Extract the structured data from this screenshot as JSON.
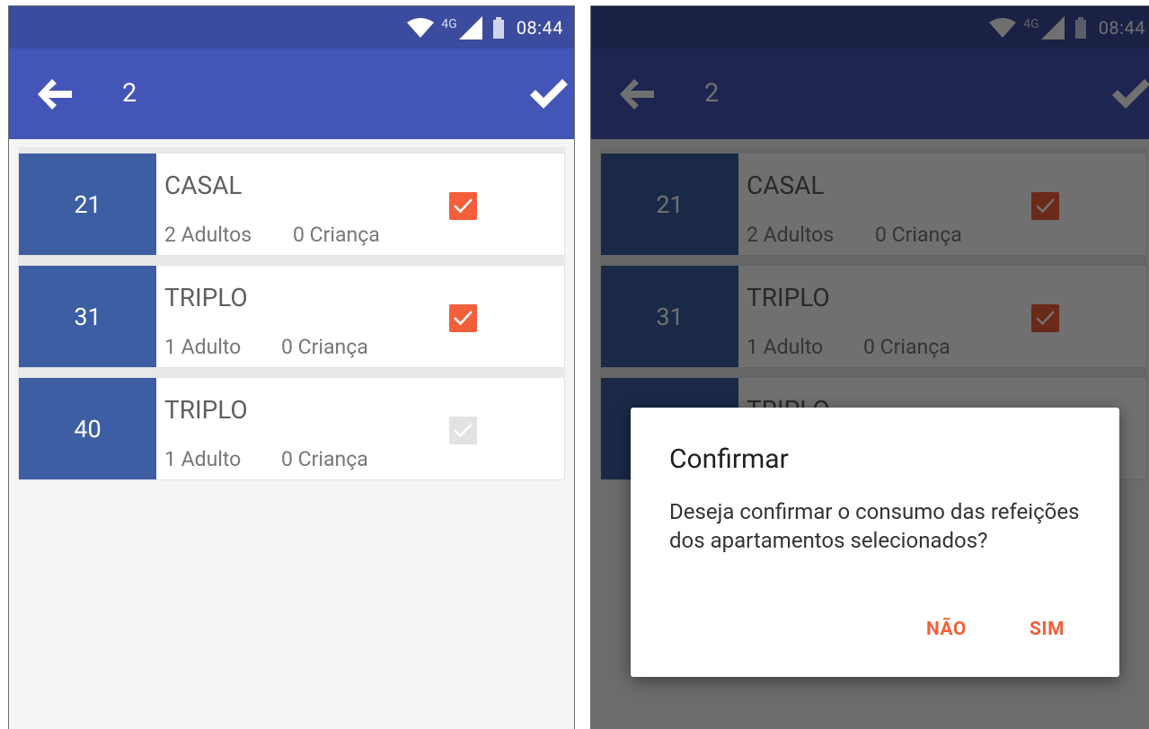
{
  "status_bar": {
    "network": "4G",
    "time": "08:44"
  },
  "app_bar": {
    "title": "2"
  },
  "rooms": [
    {
      "number": "21",
      "type": "CASAL",
      "adults": "2 Adultos",
      "children": "0 Criança",
      "checked": true
    },
    {
      "number": "31",
      "type": "TRIPLO",
      "adults": "1 Adulto",
      "children": "0 Criança",
      "checked": true
    },
    {
      "number": "40",
      "type": "TRIPLO",
      "adults": "1 Adulto",
      "children": "0 Criança",
      "checked": false
    }
  ],
  "dialog": {
    "title": "Confirmar",
    "message": "Deseja confirmar o consumo das refeições dos apartamentos selecionados?",
    "no_label": "NÃO",
    "yes_label": "SIM"
  },
  "colors": {
    "status_bar": "#3b4b9e",
    "app_bar": "#4355b7",
    "room_box": "#3d5ea3",
    "accent": "#f25f3a"
  },
  "icons": {
    "back": "arrow-left-icon",
    "confirm": "check-icon",
    "wifi": "wifi-icon",
    "signal": "signal-icon",
    "battery": "battery-icon"
  }
}
